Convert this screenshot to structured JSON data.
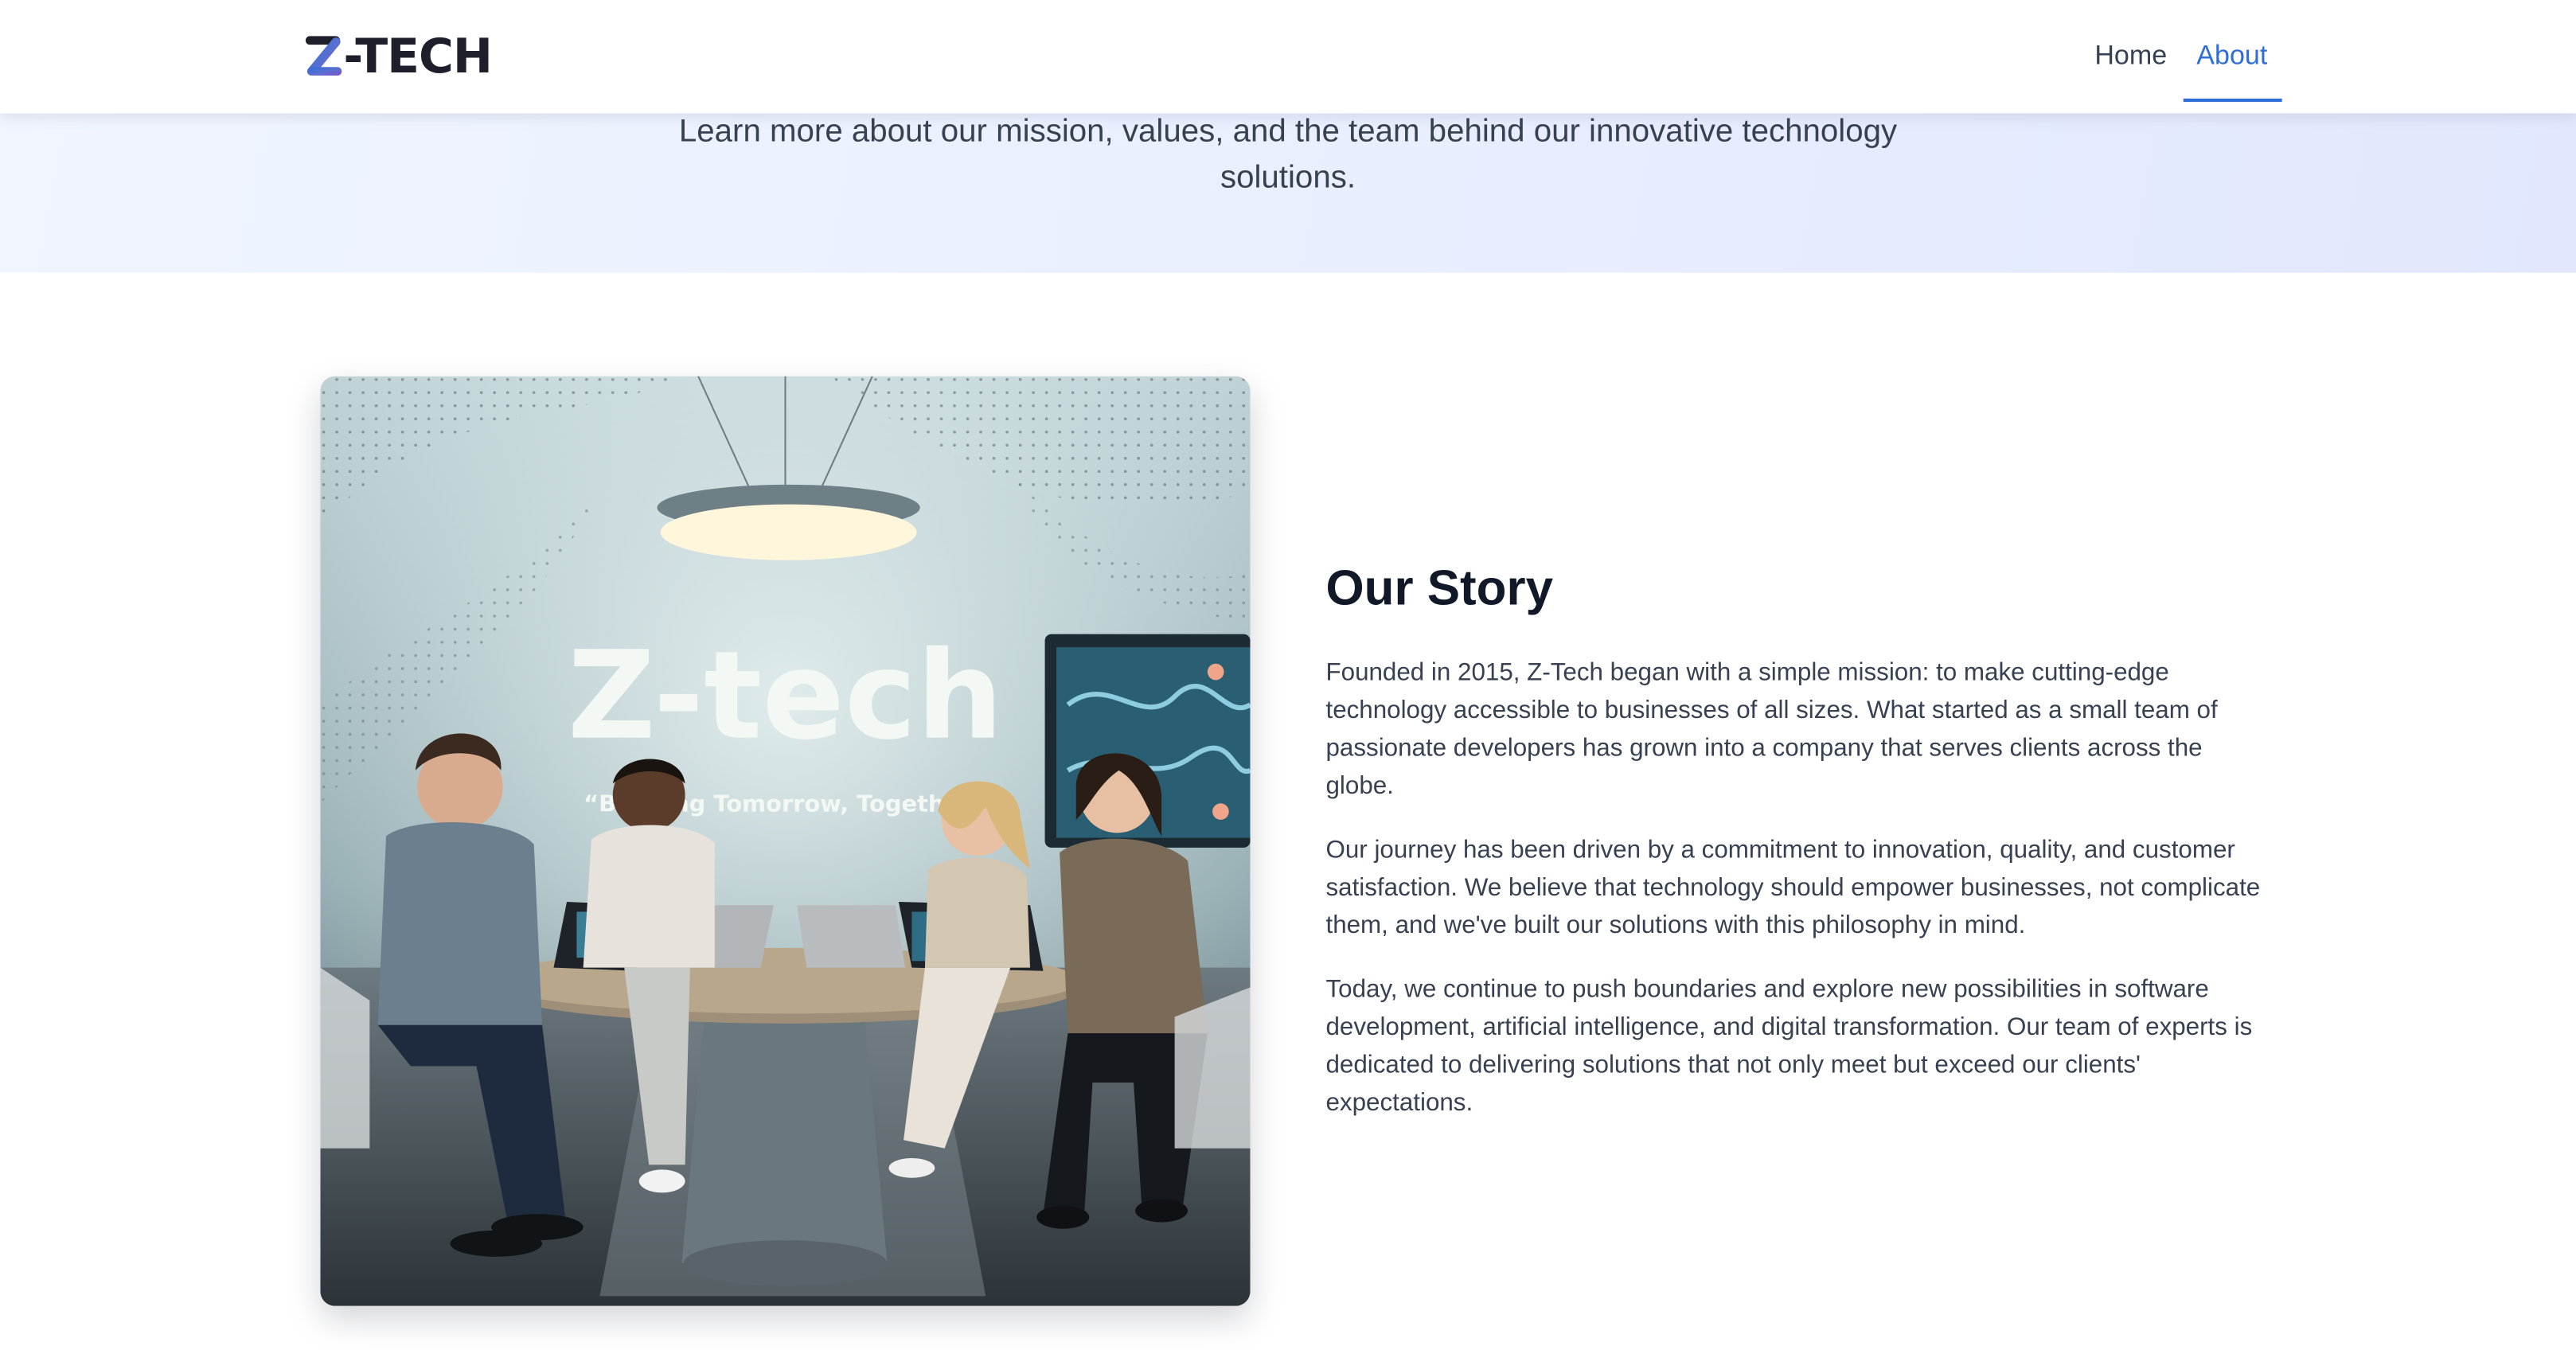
{
  "header": {
    "logo_text": "-TECH",
    "nav": [
      {
        "label": "Home",
        "active": false
      },
      {
        "label": "About",
        "active": true
      }
    ]
  },
  "hero": {
    "subtitle": "Learn more about our mission, values, and the team behind our innovative technology solutions."
  },
  "story": {
    "image": {
      "sign_text": "Z-tech",
      "slogan": "“Building Tomorrow, Together”"
    },
    "title": "Our Story",
    "paragraphs": [
      "Founded in 2015, Z-Tech began with a simple mission: to make cutting-edge technology accessible to businesses of all sizes. What started as a small team of passionate developers has grown into a company that serves clients across the globe.",
      "Our journey has been driven by a commitment to innovation, quality, and customer satisfaction. We believe that technology should empower businesses, not complicate them, and we've built our solutions with this philosophy in mind.",
      "Today, we continue to push boundaries and explore new possibilities in software development, artificial intelligence, and digital transformation. Our team of experts is dedicated to delivering solutions that not only meet but exceed our clients' expectations."
    ]
  },
  "colors": {
    "accent": "#2f6ed8",
    "heading": "#111827",
    "body_text": "#374151",
    "hero_bg_start": "#f0f5ff",
    "hero_bg_end": "#e2e7fd",
    "logo_dark": "#1e1f2b"
  },
  "icons": {
    "logo_mark": "z-logo-mark"
  }
}
